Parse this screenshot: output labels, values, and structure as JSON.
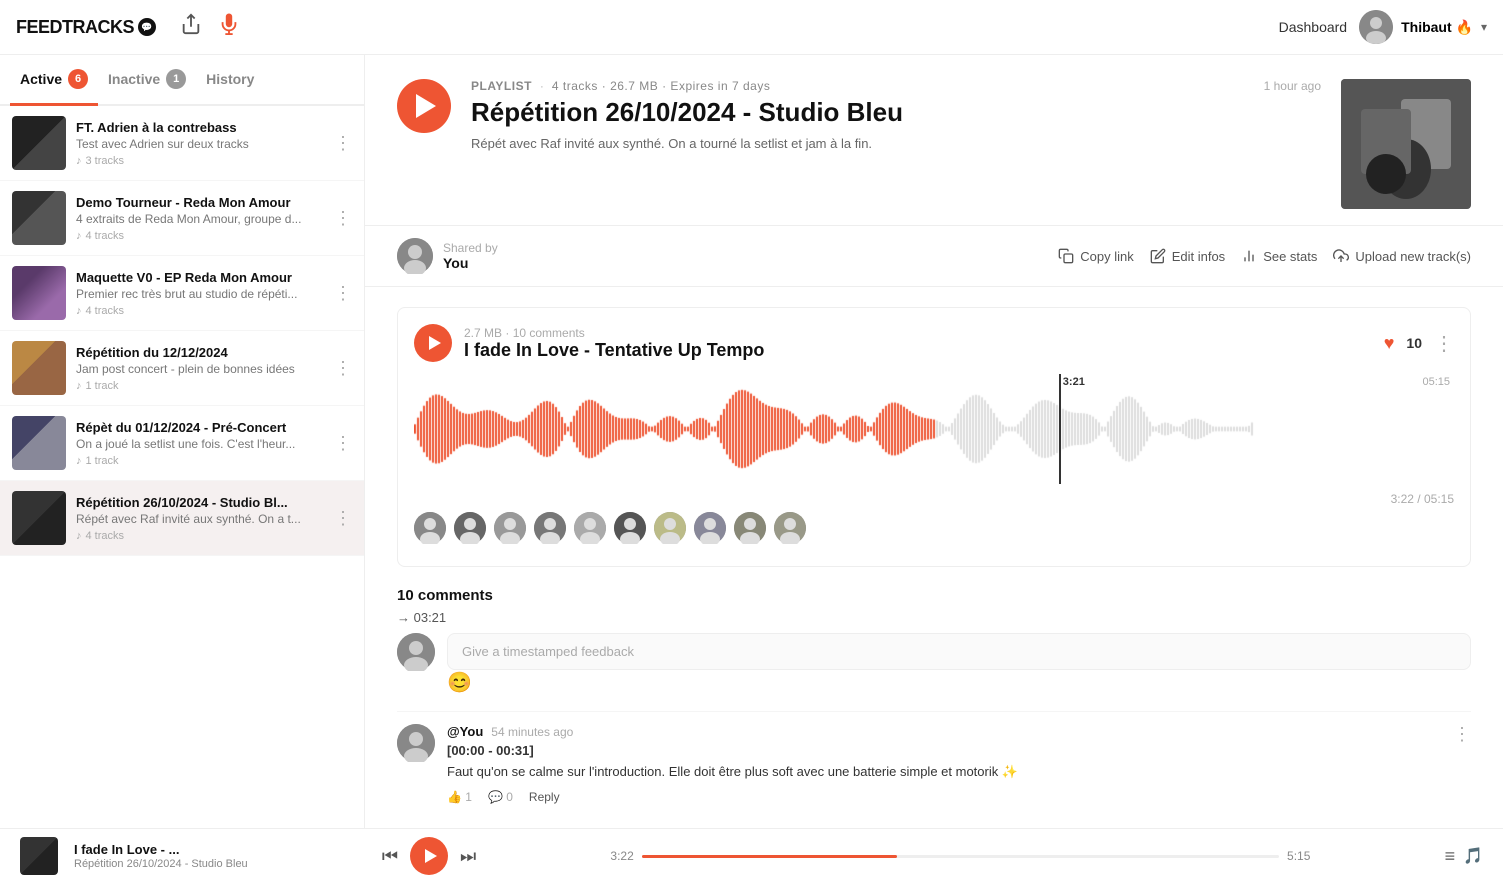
{
  "app": {
    "name": "FEEDTRACKS",
    "badge": "~"
  },
  "nav": {
    "dashboard_label": "Dashboard",
    "user_name": "Thibaut",
    "user_emoji": "🔥"
  },
  "sidebar": {
    "tabs": [
      {
        "id": "active",
        "label": "Active",
        "badge": "6",
        "active": true
      },
      {
        "id": "inactive",
        "label": "Inactive",
        "badge": "1",
        "active": false
      },
      {
        "id": "history",
        "label": "History",
        "badge": "",
        "active": false
      }
    ],
    "playlists": [
      {
        "id": "pl1",
        "title": "FT. Adrien à la contrebass",
        "desc": "Test avec Adrien sur deux tracks",
        "tracks": "3 tracks",
        "thumb_class": "thumb-1"
      },
      {
        "id": "pl2",
        "title": "Demo Tourneur - Reda Mon Amour",
        "desc": "4 extraits de Reda Mon Amour, groupe d...",
        "tracks": "4 tracks",
        "thumb_class": "thumb-2"
      },
      {
        "id": "pl3",
        "title": "Maquette V0 - EP Reda Mon Amour",
        "desc": "Premier rec très brut au studio de répéti...",
        "tracks": "4 tracks",
        "thumb_class": "thumb-3"
      },
      {
        "id": "pl4",
        "title": "Répétition du 12/12/2024",
        "desc": "Jam post concert - plein de bonnes idées",
        "tracks": "1 track",
        "thumb_class": "thumb-4"
      },
      {
        "id": "pl5",
        "title": "Répèt du 01/12/2024 - Pré-Concert",
        "desc": "On a joué la setlist une fois. C'est l'heur...",
        "tracks": "1 track",
        "thumb_class": "thumb-5"
      },
      {
        "id": "pl6",
        "title": "Répétition 26/10/2024 - Studio Bl...",
        "desc": "Répét avec Raf invité aux synthé. On a t...",
        "tracks": "4 tracks",
        "thumb_class": "thumb-6"
      }
    ]
  },
  "playlist_detail": {
    "label": "PLAYLIST",
    "stats": "4 tracks · 26.7 MB · Expires in 7 days",
    "title": "Répétition 26/10/2024 - Studio Bleu",
    "description": "Répét avec Raf invité aux synthé. On a tourné la setlist et jam à la fin.",
    "time_ago": "1 hour ago",
    "shared_by_label": "Shared by",
    "shared_by_name": "You",
    "actions": {
      "copy_link": "Copy link",
      "edit_infos": "Edit infos",
      "see_stats": "See stats",
      "upload": "Upload new track(s)"
    }
  },
  "track": {
    "size": "2.7 MB",
    "comments_count": "10 comments",
    "title": "I fade In Love - Tentative Up Tempo",
    "likes": "10",
    "playhead_time": "3:21",
    "total_time": "05:15",
    "current_position": "3:22",
    "time_display": "3:22 / 05:15"
  },
  "comments": {
    "section_title": "10 comments",
    "timestamp_arrow": "→ 03:21",
    "input_placeholder": "Give a timestamped feedback",
    "comment_items": [
      {
        "author": "@You",
        "age": "54 minutes ago",
        "range": "[00:00 - 00:31]",
        "text": "Faut qu'on se calme sur l'introduction. Elle doit être plus soft avec une batterie simple et motorik ✨"
      }
    ]
  },
  "player": {
    "track_title": "I fade In Love - ...",
    "playlist_label": "Répétition\n26/10/2024 - Studio\nBleu",
    "time_current": "3:22",
    "time_total": "5:15"
  }
}
